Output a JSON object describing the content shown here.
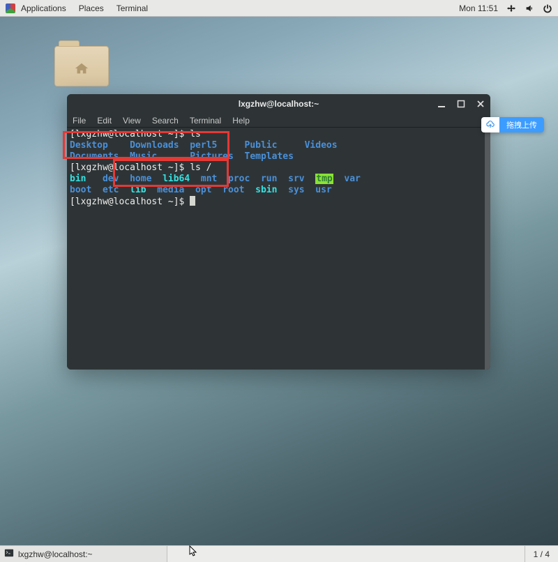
{
  "topbar": {
    "applications": "Applications",
    "places": "Places",
    "terminal": "Terminal",
    "clock": "Mon 11:51"
  },
  "desktop": {
    "home_folder_name": "Home"
  },
  "terminal": {
    "title": "lxgzhw@localhost:~",
    "menu": {
      "file": "File",
      "edit": "Edit",
      "view": "View",
      "search": "Search",
      "terminal": "Terminal",
      "help": "Help"
    },
    "lines": {
      "prompt1_pre": "[lxgzhw@localhost ~]$ ",
      "cmd1": "ls",
      "ls_home_row1": {
        "a": "Desktop",
        "b": "Downloads",
        "c": "perl5",
        "d": "Public",
        "e": "Videos"
      },
      "ls_home_row2": {
        "a": "Documents",
        "b": "Music",
        "c": "Pictures",
        "d": "Templates"
      },
      "prompt2_pre": "[lxgzhw@localhost ~]$ ",
      "cmd2": "ls /",
      "ls_root_row1": {
        "a": "bin",
        "b": "dev",
        "c": "home",
        "d": "lib64",
        "e": "mnt",
        "f": "proc",
        "g": "run",
        "h": "srv",
        "i": "tmp",
        "j": "var"
      },
      "ls_root_row2": {
        "a": "boot",
        "b": "etc",
        "c": "lib",
        "d": "media",
        "e": "opt",
        "f": "root",
        "g": "sbin",
        "h": "sys",
        "i": "usr"
      },
      "prompt3_pre": "[lxgzhw@localhost ~]$ "
    }
  },
  "overlay": {
    "pill_label": "拖拽上传"
  },
  "taskbar": {
    "item1": "lxgzhw@localhost:~",
    "workspace": "1 / 4"
  }
}
